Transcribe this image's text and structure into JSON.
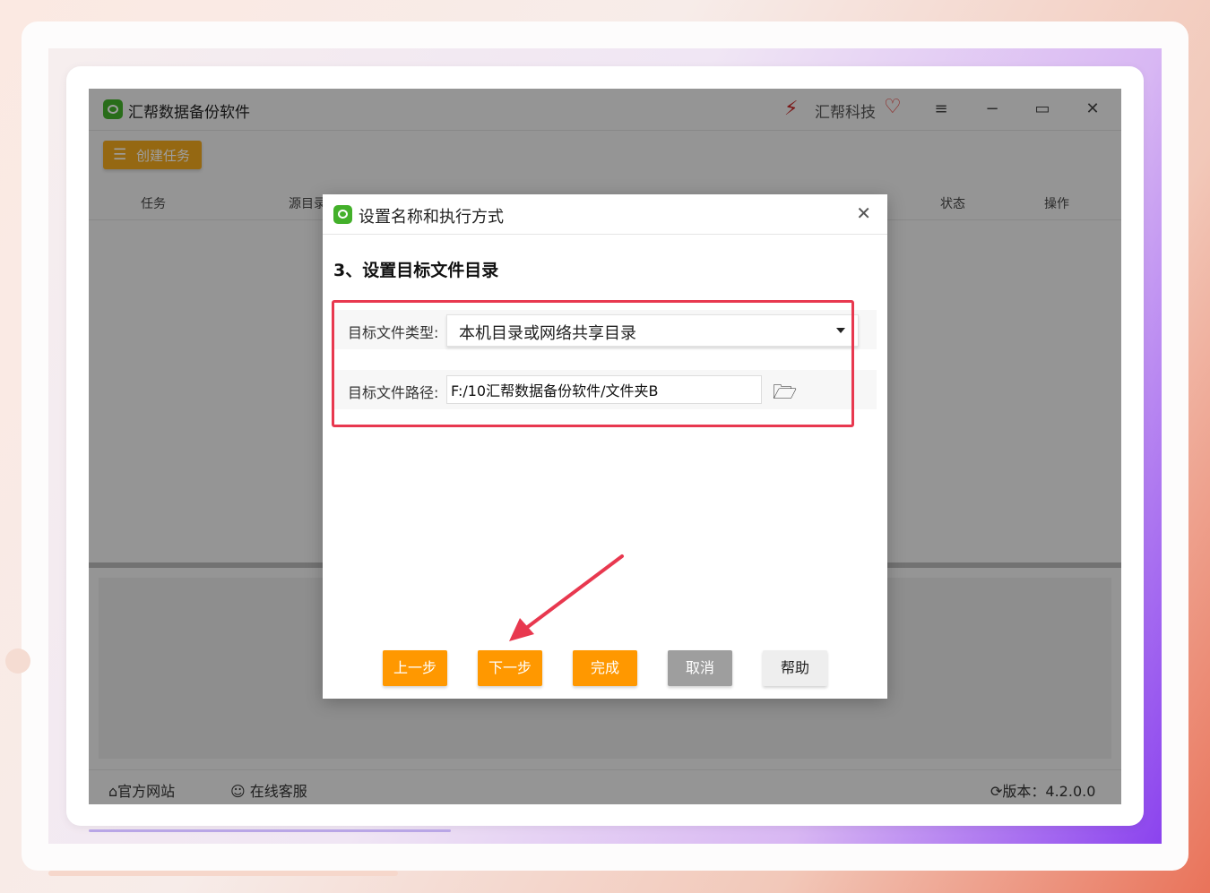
{
  "app": {
    "title": "汇帮数据备份软件",
    "brand": "汇帮科技",
    "create_task_label": "创建任务"
  },
  "table_headers": [
    "任务",
    "源目录",
    "状态",
    "操作"
  ],
  "statusbar": {
    "website": "官方网站",
    "support": "在线客服",
    "version": "版本：4.2.0.0"
  },
  "dialog": {
    "title": "设置名称和执行方式",
    "step_title": "3、设置目标文件目录",
    "target_type_label": "目标文件类型:",
    "target_type_value": "本机目录或网络共享目录",
    "target_path_label": "目标文件路径:",
    "target_path_value": "F:/10汇帮数据备份软件/文件夹B",
    "buttons": {
      "prev": "上一步",
      "next": "下一步",
      "finish": "完成",
      "cancel": "取消",
      "help": "帮助"
    }
  },
  "colors": {
    "accent_orange": "#ff9800",
    "create_button": "#f0a81d",
    "highlight_red": "#e8384f",
    "logo_green": "#43b02a"
  },
  "icons": [
    "app-logo-icon",
    "brand-logo-icon",
    "heart-icon",
    "menu-icon",
    "minimize-icon",
    "maximize-icon",
    "close-icon",
    "task-icon",
    "folder-open-icon",
    "home-icon",
    "support-icon",
    "refresh-icon",
    "dropdown-caret-icon"
  ]
}
